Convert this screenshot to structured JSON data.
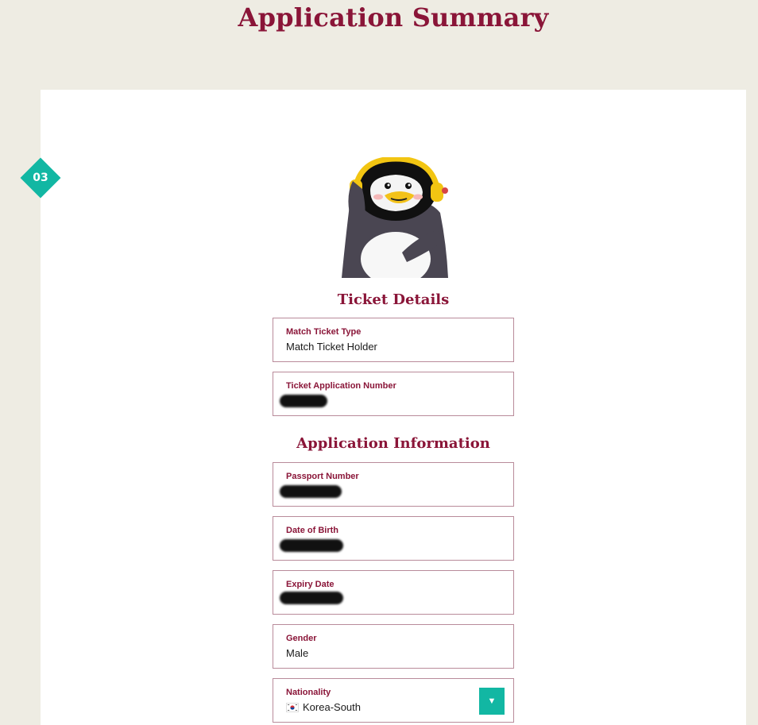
{
  "page": {
    "title": "Application Summary"
  },
  "step": {
    "number": "03"
  },
  "colors": {
    "brand": "#8a1538",
    "accent": "#12b7a3",
    "background": "#eeece3"
  },
  "ticket_details": {
    "title": "Ticket Details",
    "fields": [
      {
        "label": "Match Ticket Type",
        "value": "Match Ticket Holder"
      },
      {
        "label": "Ticket Application Number",
        "value": "",
        "redacted": true
      }
    ]
  },
  "application_information": {
    "title": "Application Information",
    "fields": [
      {
        "label": "Passport Number",
        "value": "",
        "redacted": true
      },
      {
        "label": "Date of Birth",
        "value": "",
        "redacted": true
      },
      {
        "label": "Expiry Date",
        "value": "",
        "redacted": true
      },
      {
        "label": "Gender",
        "value": "Male"
      },
      {
        "label": "Nationality",
        "value": "Korea-South",
        "flag_icon": "south-korea-flag-icon",
        "control_icon": "chevron-down-icon"
      }
    ]
  }
}
